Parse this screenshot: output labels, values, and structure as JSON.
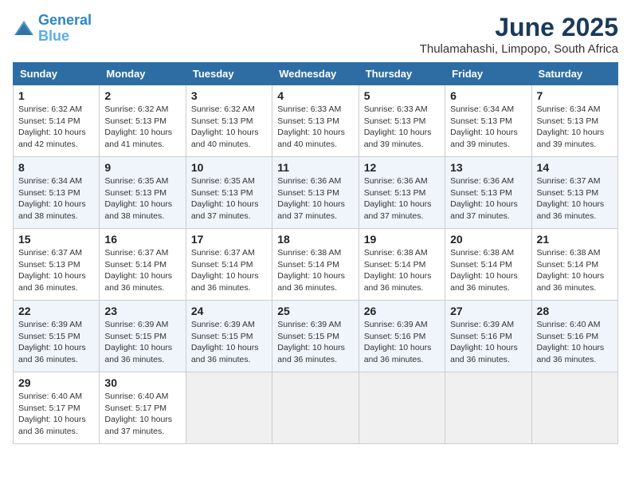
{
  "header": {
    "logo_line1": "General",
    "logo_line2": "Blue",
    "month": "June 2025",
    "location": "Thulamahashi, Limpopo, South Africa"
  },
  "days_of_week": [
    "Sunday",
    "Monday",
    "Tuesday",
    "Wednesday",
    "Thursday",
    "Friday",
    "Saturday"
  ],
  "weeks": [
    [
      {
        "day": "1",
        "sunrise": "6:32 AM",
        "sunset": "5:14 PM",
        "daylight": "10 hours and 42 minutes."
      },
      {
        "day": "2",
        "sunrise": "6:32 AM",
        "sunset": "5:13 PM",
        "daylight": "10 hours and 41 minutes."
      },
      {
        "day": "3",
        "sunrise": "6:32 AM",
        "sunset": "5:13 PM",
        "daylight": "10 hours and 40 minutes."
      },
      {
        "day": "4",
        "sunrise": "6:33 AM",
        "sunset": "5:13 PM",
        "daylight": "10 hours and 40 minutes."
      },
      {
        "day": "5",
        "sunrise": "6:33 AM",
        "sunset": "5:13 PM",
        "daylight": "10 hours and 39 minutes."
      },
      {
        "day": "6",
        "sunrise": "6:34 AM",
        "sunset": "5:13 PM",
        "daylight": "10 hours and 39 minutes."
      },
      {
        "day": "7",
        "sunrise": "6:34 AM",
        "sunset": "5:13 PM",
        "daylight": "10 hours and 39 minutes."
      }
    ],
    [
      {
        "day": "8",
        "sunrise": "6:34 AM",
        "sunset": "5:13 PM",
        "daylight": "10 hours and 38 minutes."
      },
      {
        "day": "9",
        "sunrise": "6:35 AM",
        "sunset": "5:13 PM",
        "daylight": "10 hours and 38 minutes."
      },
      {
        "day": "10",
        "sunrise": "6:35 AM",
        "sunset": "5:13 PM",
        "daylight": "10 hours and 37 minutes."
      },
      {
        "day": "11",
        "sunrise": "6:36 AM",
        "sunset": "5:13 PM",
        "daylight": "10 hours and 37 minutes."
      },
      {
        "day": "12",
        "sunrise": "6:36 AM",
        "sunset": "5:13 PM",
        "daylight": "10 hours and 37 minutes."
      },
      {
        "day": "13",
        "sunrise": "6:36 AM",
        "sunset": "5:13 PM",
        "daylight": "10 hours and 37 minutes."
      },
      {
        "day": "14",
        "sunrise": "6:37 AM",
        "sunset": "5:13 PM",
        "daylight": "10 hours and 36 minutes."
      }
    ],
    [
      {
        "day": "15",
        "sunrise": "6:37 AM",
        "sunset": "5:13 PM",
        "daylight": "10 hours and 36 minutes."
      },
      {
        "day": "16",
        "sunrise": "6:37 AM",
        "sunset": "5:14 PM",
        "daylight": "10 hours and 36 minutes."
      },
      {
        "day": "17",
        "sunrise": "6:37 AM",
        "sunset": "5:14 PM",
        "daylight": "10 hours and 36 minutes."
      },
      {
        "day": "18",
        "sunrise": "6:38 AM",
        "sunset": "5:14 PM",
        "daylight": "10 hours and 36 minutes."
      },
      {
        "day": "19",
        "sunrise": "6:38 AM",
        "sunset": "5:14 PM",
        "daylight": "10 hours and 36 minutes."
      },
      {
        "day": "20",
        "sunrise": "6:38 AM",
        "sunset": "5:14 PM",
        "daylight": "10 hours and 36 minutes."
      },
      {
        "day": "21",
        "sunrise": "6:38 AM",
        "sunset": "5:14 PM",
        "daylight": "10 hours and 36 minutes."
      }
    ],
    [
      {
        "day": "22",
        "sunrise": "6:39 AM",
        "sunset": "5:15 PM",
        "daylight": "10 hours and 36 minutes."
      },
      {
        "day": "23",
        "sunrise": "6:39 AM",
        "sunset": "5:15 PM",
        "daylight": "10 hours and 36 minutes."
      },
      {
        "day": "24",
        "sunrise": "6:39 AM",
        "sunset": "5:15 PM",
        "daylight": "10 hours and 36 minutes."
      },
      {
        "day": "25",
        "sunrise": "6:39 AM",
        "sunset": "5:15 PM",
        "daylight": "10 hours and 36 minutes."
      },
      {
        "day": "26",
        "sunrise": "6:39 AM",
        "sunset": "5:16 PM",
        "daylight": "10 hours and 36 minutes."
      },
      {
        "day": "27",
        "sunrise": "6:39 AM",
        "sunset": "5:16 PM",
        "daylight": "10 hours and 36 minutes."
      },
      {
        "day": "28",
        "sunrise": "6:40 AM",
        "sunset": "5:16 PM",
        "daylight": "10 hours and 36 minutes."
      }
    ],
    [
      {
        "day": "29",
        "sunrise": "6:40 AM",
        "sunset": "5:17 PM",
        "daylight": "10 hours and 36 minutes."
      },
      {
        "day": "30",
        "sunrise": "6:40 AM",
        "sunset": "5:17 PM",
        "daylight": "10 hours and 37 minutes."
      },
      null,
      null,
      null,
      null,
      null
    ]
  ]
}
